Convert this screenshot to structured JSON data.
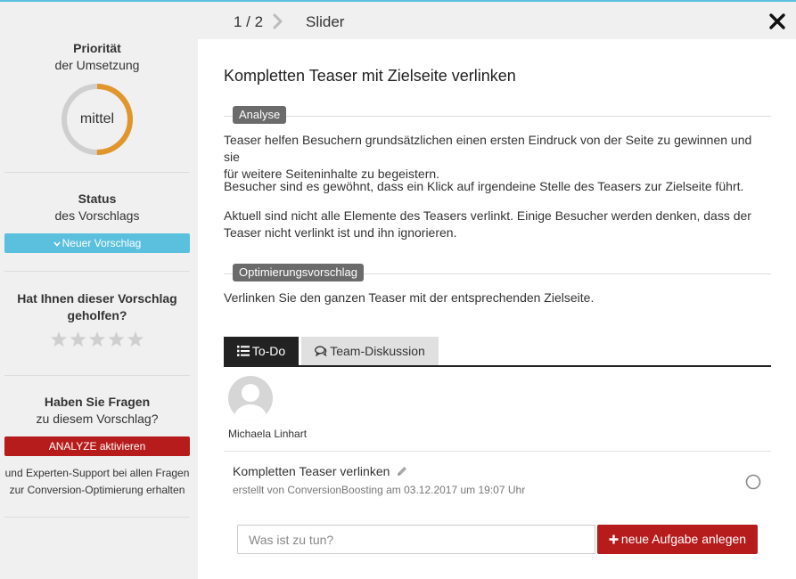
{
  "topbar": {
    "pager": "1 / 2",
    "crumb": "Slider"
  },
  "sidebar": {
    "priority": {
      "title": "Priorität",
      "subtitle": "der Umsetzung",
      "value": "mittel",
      "level": 0.5
    },
    "status": {
      "title": "Status",
      "subtitle": "des Vorschlags",
      "button": "Neuer Vorschlag"
    },
    "rating": {
      "title_line1": "Hat Ihnen dieser Vorschlag",
      "title_line2": "geholfen?",
      "stars": 0,
      "max_stars": 5
    },
    "questions": {
      "title": "Haben Sie Fragen",
      "subtitle": "zu diesem Vorschlag?",
      "button": "ANALYZE aktivieren",
      "note_line1": "und Experten-Support bei allen Fragen",
      "note_line2": "zur Conversion-Optimierung erhalten"
    }
  },
  "main": {
    "title": "Kompletten Teaser mit Zielseite verlinken",
    "analysis": {
      "tag": "Analyse",
      "p1_line1": "Teaser helfen Besuchern grundsätzlichen einen ersten Eindruck von der Seite zu gewinnen und sie",
      "p1_line2": "für weitere Seiteninhalte zu begeistern.",
      "p2": "Besucher sind es gewöhnt, dass ein Klick auf irgendeine Stelle des Teasers zur Zielseite führt.",
      "p3_line1": "Aktuell sind nicht alle Elemente des Teasers verlinkt. Einige Besucher werden denken, dass der",
      "p3_line2": "Teaser nicht verlinkt ist und ihn ignorieren."
    },
    "suggestion": {
      "tag": "Optimierungsvorschlag",
      "text": "Verlinken Sie den ganzen Teaser mit der entsprechenden Zielseite."
    },
    "tabs": [
      {
        "label": "To-Do"
      },
      {
        "label": "Team-Diskussion"
      }
    ],
    "todo": {
      "author": "Michaela Linhart",
      "task_title": "Kompletten Teaser verlinken",
      "task_meta": "erstellt von ConversionBoosting am 03.12.2017 um 19:07 Uhr",
      "input_placeholder": "Was ist zu tun?",
      "add_button": "neue Aufgabe anlegen"
    }
  },
  "colors": {
    "accent_blue": "#5bc0de",
    "danger_red": "#b71c1c",
    "priority_orange": "#e0962b",
    "dark": "#222222"
  }
}
